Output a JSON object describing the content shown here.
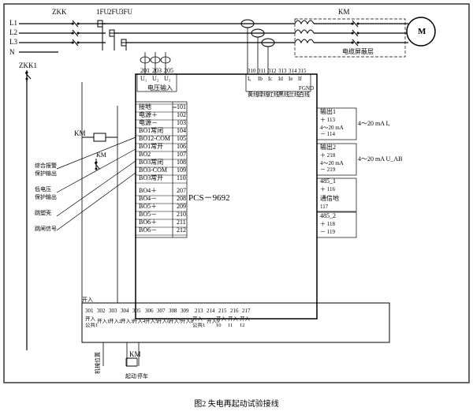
{
  "title": "图2  失电再起动试验接线",
  "diagram": {
    "components": {
      "ZKK": "ZKK",
      "ZKK1": "ZKK1",
      "KM": "KM",
      "M": "M",
      "fuses": [
        "1FU",
        "2FU",
        "3FU"
      ],
      "pcs": "PCS－9692",
      "cable_shield": "电缆屏蔽层",
      "FGND": "FGND",
      "lines_left": [
        "L1",
        "L2",
        "L3",
        "N"
      ],
      "terminals_top": [
        "201",
        "203",
        "205",
        "310",
        "311",
        "312",
        "313",
        "314",
        "315"
      ],
      "terminal_labels_top": [
        "U₁",
        "U₂",
        "U₃",
        "Iₐ",
        "Ib",
        "Ic",
        "Id",
        "Ie",
        "If"
      ],
      "voltage_input": "电压输入",
      "wire_colors": [
        "黄线",
        "绿线",
        "红线",
        "黑线",
        "兰线",
        "白线"
      ],
      "terminal_groups": {
        "接地": "101",
        "电源+": "102",
        "电源-": "103",
        "BO1常闭": "104",
        "BO12-COM": "105",
        "BO1常开": "106",
        "BO2": "107",
        "BO3常闭": "108",
        "BO3-COM": "109",
        "BO3常开": "110",
        "BO4+": "207",
        "BO4-": "208",
        "BO5+": "209",
        "BO5-": "210",
        "BO6+": "211",
        "BO6-": "212"
      },
      "outputs": {
        "输出1": {
          "plus": "113",
          "minus": "114",
          "label": "4～20 mA Iₐ"
        },
        "输出2": {
          "plus": "218",
          "minus": "219",
          "label": "4～20 mA U_AB"
        },
        "485_1": {
          "plus": "116",
          "minus": "",
          "label": "通信地"
        },
        "通信地": "117",
        "485_2": {
          "plus": "118",
          "minus": "119"
        }
      },
      "bottom_terminals": [
        {
          "num": "301",
          "label": "开入公共1"
        },
        {
          "num": "302",
          "label": "开入1"
        },
        {
          "num": "303",
          "label": "开入2"
        },
        {
          "num": "304",
          "label": "开入3"
        },
        {
          "num": "305",
          "label": "开入4"
        },
        {
          "num": "306",
          "label": "开入5"
        },
        {
          "num": "307",
          "label": "开入6"
        },
        {
          "num": "308",
          "label": "开入7"
        },
        {
          "num": "309",
          "label": "开入8"
        },
        {
          "num": "213",
          "label": "开入公共1"
        },
        {
          "num": "214",
          "label": "开入9"
        },
        {
          "num": "215",
          "label": "开入10"
        },
        {
          "num": "216",
          "label": "开入11"
        },
        {
          "num": "217",
          "label": "开入12"
        }
      ],
      "bottom_labels": [
        "机械位置",
        "起动",
        "停车"
      ],
      "left_labels": [
        "综合报警保护输出",
        "低电压保护输出",
        "跳塑壳",
        "跳闸信号"
      ]
    }
  }
}
